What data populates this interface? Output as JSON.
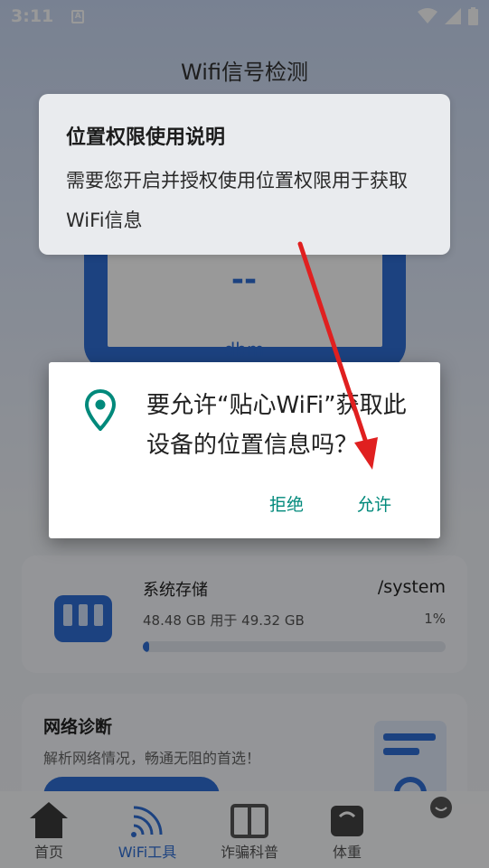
{
  "status_bar": {
    "time": "3:11",
    "notification_icon": "A",
    "icons": [
      "wifi-icon",
      "signal-icon",
      "battery-icon"
    ]
  },
  "app": {
    "title": "Wifi信号检测",
    "gauge": {
      "value": "--",
      "unit": "dbm"
    },
    "storage": {
      "title": "系统存储",
      "path": "/system",
      "detail": "48.48 GB 用于 49.32 GB",
      "percent_label": "1%",
      "percent": 1
    },
    "network": {
      "title": "网络诊断",
      "subtitle": "解析网络情况，畅通无阻的首选！"
    },
    "nav": [
      {
        "label": "首页",
        "icon": "home-icon"
      },
      {
        "label": "WiFi工具",
        "icon": "wifi-icon"
      },
      {
        "label": "诈骗科普",
        "icon": "book-icon"
      },
      {
        "label": "体重",
        "icon": "scale-icon"
      },
      {
        "label": "",
        "icon": "profile-icon"
      }
    ]
  },
  "explain_popup": {
    "title": "位置权限使用说明",
    "body": "需要您开启并授权使用位置权限用于获取WiFi信息"
  },
  "permission_dialog": {
    "message": "要允许“贴心WiFi”获取此设备的位置信息吗？",
    "deny_label": "拒绝",
    "allow_label": "允许",
    "icon": "location-pin-icon"
  },
  "colors": {
    "accent": "#00897b",
    "brand": "#2f6fd6",
    "arrow": "#e02020"
  }
}
